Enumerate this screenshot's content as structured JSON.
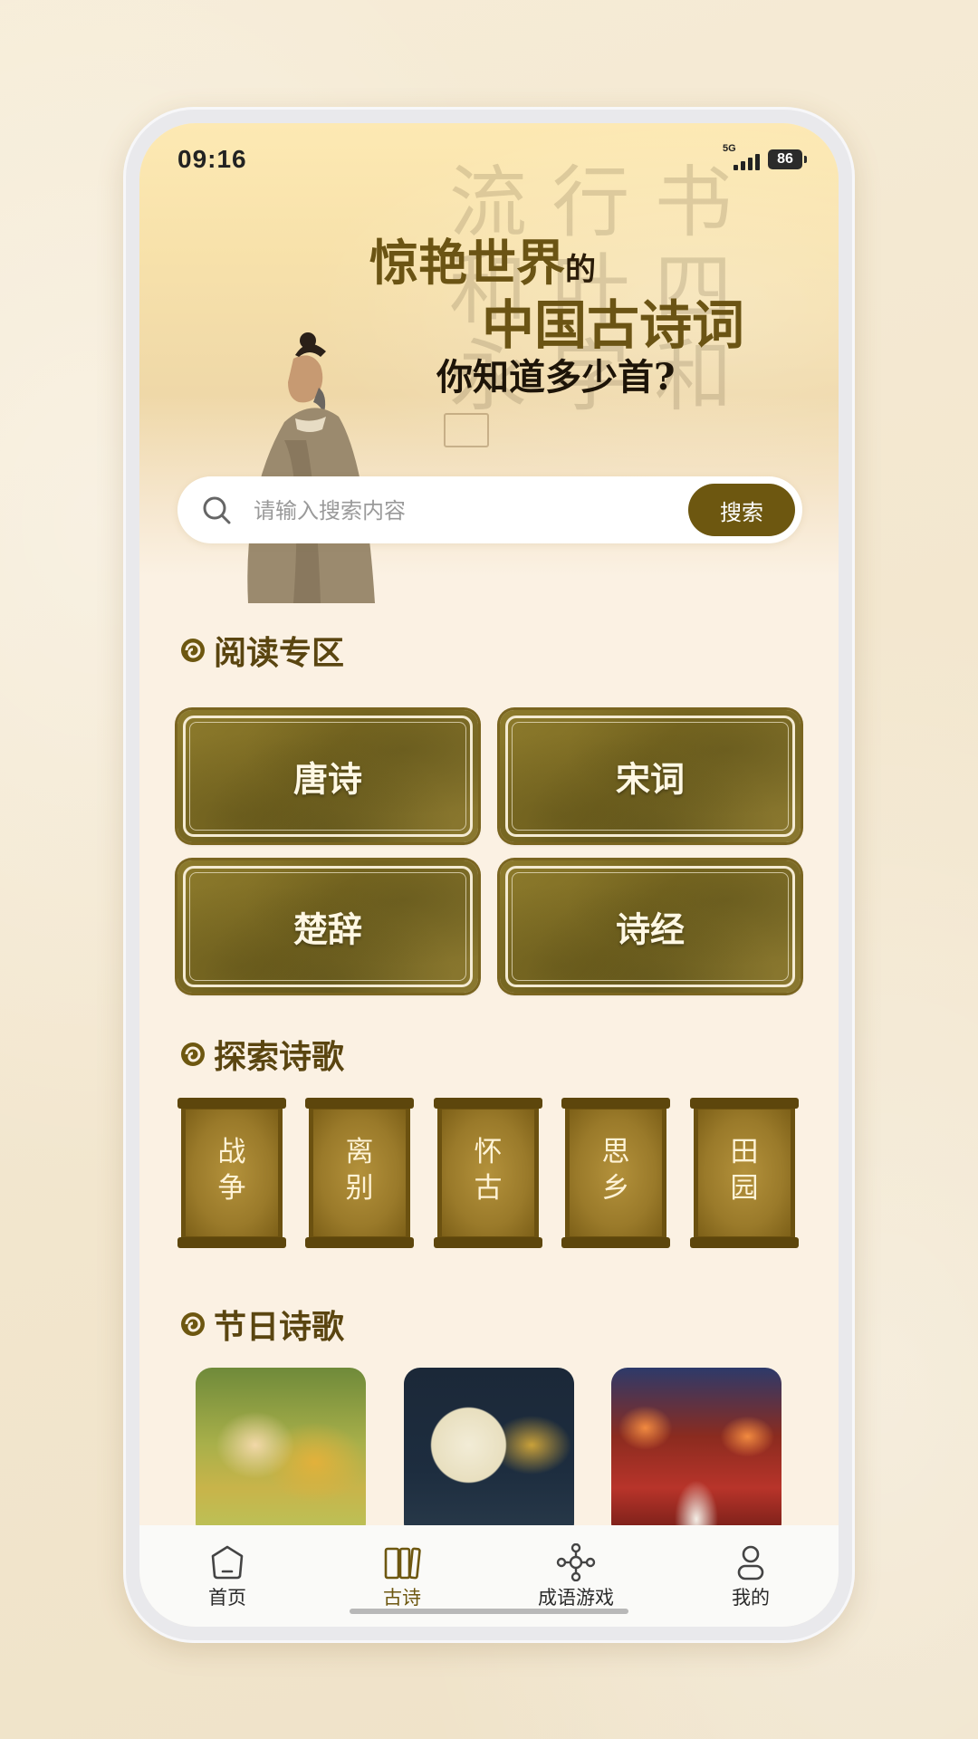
{
  "status_bar": {
    "time": "09:16",
    "network": "5G",
    "battery": "86"
  },
  "hero": {
    "line1_main": "惊艳世界",
    "line1_particle": "的",
    "line2": "中国古诗词",
    "line3": "你知道多少首?"
  },
  "search": {
    "placeholder": "请输入搜索内容",
    "value": "",
    "button_label": "搜索"
  },
  "reading_section": {
    "title": "阅读专区",
    "tiles": [
      {
        "label": "唐诗"
      },
      {
        "label": "宋词"
      },
      {
        "label": "楚辞"
      },
      {
        "label": "诗经"
      }
    ]
  },
  "explore_section": {
    "title": "探索诗歌",
    "scrolls": [
      {
        "label": "战争"
      },
      {
        "label": "离别"
      },
      {
        "label": "怀古"
      },
      {
        "label": "思乡"
      },
      {
        "label": "田园"
      }
    ]
  },
  "festival_section": {
    "title": "节日诗歌"
  },
  "tab_bar": {
    "items": [
      {
        "label": "首页",
        "icon": "home-icon"
      },
      {
        "label": "古诗",
        "icon": "book-icon",
        "active": true
      },
      {
        "label": "成语游戏",
        "icon": "network-icon"
      },
      {
        "label": "我的",
        "icon": "user-icon"
      }
    ]
  },
  "colors": {
    "accent": "#6d5710",
    "section_title": "#5a4510",
    "background": "#fbf1e3"
  }
}
